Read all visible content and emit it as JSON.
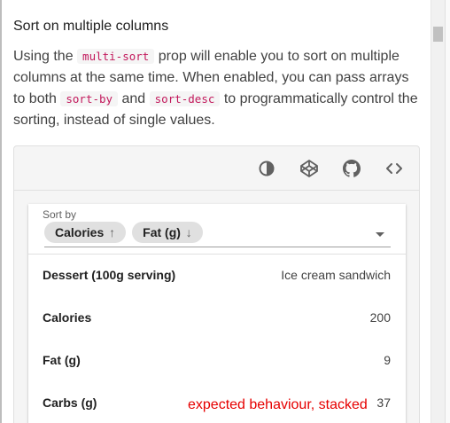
{
  "section": {
    "title": "Sort on multiple columns",
    "paragraph": {
      "t1": "Using the ",
      "code1": "multi-sort",
      "t2": " prop will enable you to sort on multiple columns at the same time. When enabled, you can pass arrays to both ",
      "code2": "sort-by",
      "t3": " and ",
      "code3": "sort-desc",
      "t4": " to programmatically control the sorting, instead of single values."
    }
  },
  "toolbar": {
    "icons": [
      "invert-colors-icon",
      "codepen-icon",
      "github-icon",
      "code-icon"
    ]
  },
  "sort": {
    "label": "Sort by",
    "chips": [
      {
        "label": "Calories",
        "arrow": "↑"
      },
      {
        "label": "Fat (g)",
        "arrow": "↓"
      }
    ]
  },
  "rows": [
    {
      "key": "Dessert (100g serving)",
      "value": "Ice cream sandwich"
    },
    {
      "key": "Calories",
      "value": "200"
    },
    {
      "key": "Fat (g)",
      "value": "9"
    },
    {
      "key": "Carbs (g)",
      "value": "37"
    }
  ],
  "annotation": "expected behaviour, stacked",
  "colors": {
    "code_text": "#c2185b",
    "annotation": "#e60000"
  }
}
